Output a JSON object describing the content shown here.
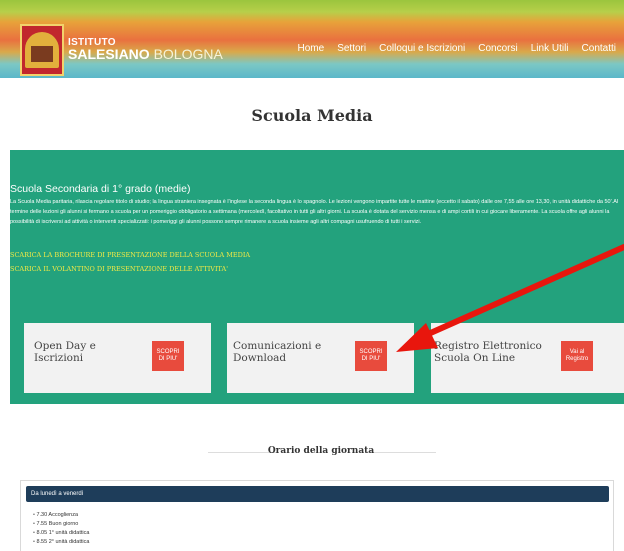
{
  "header": {
    "logo_top": "ISTITUTO",
    "logo_main_a": "SALESIANO",
    "logo_main_b": " BOLOGNA",
    "nav": [
      "Home",
      "Settori",
      "Colloqui e Iscrizioni",
      "Concorsi",
      "Link Utili",
      "Contatti"
    ]
  },
  "page": {
    "title": "Scuola Media"
  },
  "intro": {
    "heading": "Scuola Secondaria di 1° grado (medie)",
    "body": "La Scuola Media paritaria, rilascia regolare titolo di studio; la lingua straniera insegnata è l'inglese la seconda lingua è lo spagnolo. Le lezioni vengono impartite tutte le mattine (eccetto il sabato) dalle ore 7,55 alle ore 13,30, in unità didattiche da 50'.Al termine delle lezioni gli alunni si fermano a scuola per un pomeriggio obbligatorio a settimana (mercoledì, facoltativo in tutti gli altri giorni. La scuola è dotata del servizio mensa e di ampi cortili in cui giocare liberamente. La scuola offre agli alunni la possibilità di iscriversi ad attività o interventi specializzati: i pomeriggi gli alunni possono sempre rimanere a scuola insieme agli altri compagni usufruendo di tutti i servizi.",
    "link_brochure": "SCARICA LA BROCHURE DI PRESENTAZIONE DELLA SCUOLA MEDIA",
    "link_volantino": "SCARICA IL VOLANTINO DI PRESENTAZIONE DELLE ATTIVITA'"
  },
  "cards": [
    {
      "title": "Open Day e Iscrizioni",
      "button": "SCOPRI DI PIU'"
    },
    {
      "title": "Comunicazioni e Download",
      "button": "SCOPRI DI PIU'"
    },
    {
      "title": "Registro Elettronico Scuola On Line",
      "button": "Vai al Registro"
    }
  ],
  "orario": {
    "title": "Orario della giornata",
    "panel_header": "Da lunedì a venerdì",
    "items": [
      "7.30 Accoglienza",
      "7.55 Buon giorno",
      "8.05 1° unità didattica",
      "8.55 2° unità didattica"
    ]
  },
  "colors": {
    "green": "#23a27d",
    "button_red": "#e84b3d",
    "link_yellow": "#f2ea45",
    "arrow_red": "#e8160d",
    "panel_header": "#1e3d5a"
  },
  "annotation": {
    "type": "arrow",
    "color": "#e8160d",
    "points_to": "Comunicazioni e Download button"
  }
}
